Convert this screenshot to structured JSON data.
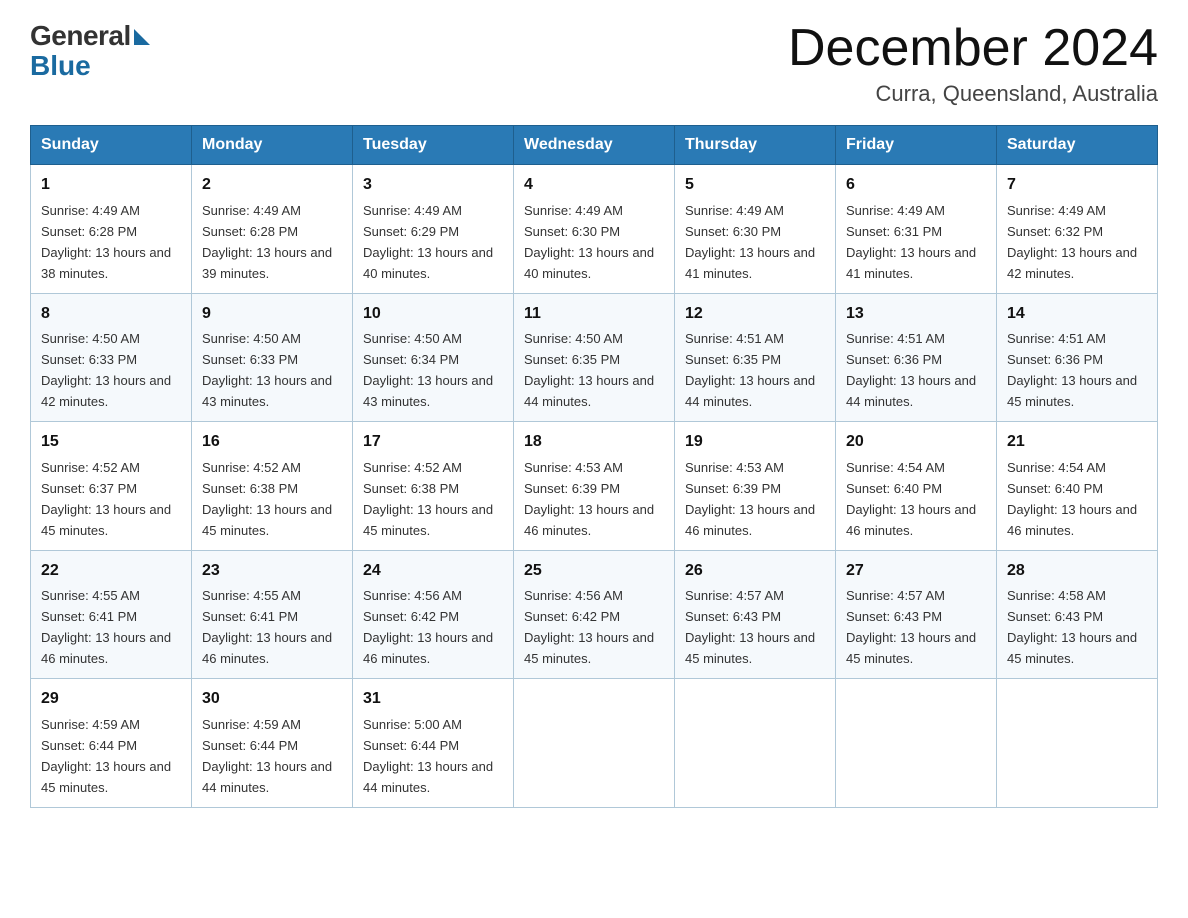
{
  "header": {
    "logo_general": "General",
    "logo_blue": "Blue",
    "month_title": "December 2024",
    "location": "Curra, Queensland, Australia"
  },
  "days_of_week": [
    "Sunday",
    "Monday",
    "Tuesday",
    "Wednesday",
    "Thursday",
    "Friday",
    "Saturday"
  ],
  "weeks": [
    [
      {
        "day": "1",
        "sunrise": "4:49 AM",
        "sunset": "6:28 PM",
        "daylight": "13 hours and 38 minutes."
      },
      {
        "day": "2",
        "sunrise": "4:49 AM",
        "sunset": "6:28 PM",
        "daylight": "13 hours and 39 minutes."
      },
      {
        "day": "3",
        "sunrise": "4:49 AM",
        "sunset": "6:29 PM",
        "daylight": "13 hours and 40 minutes."
      },
      {
        "day": "4",
        "sunrise": "4:49 AM",
        "sunset": "6:30 PM",
        "daylight": "13 hours and 40 minutes."
      },
      {
        "day": "5",
        "sunrise": "4:49 AM",
        "sunset": "6:30 PM",
        "daylight": "13 hours and 41 minutes."
      },
      {
        "day": "6",
        "sunrise": "4:49 AM",
        "sunset": "6:31 PM",
        "daylight": "13 hours and 41 minutes."
      },
      {
        "day": "7",
        "sunrise": "4:49 AM",
        "sunset": "6:32 PM",
        "daylight": "13 hours and 42 minutes."
      }
    ],
    [
      {
        "day": "8",
        "sunrise": "4:50 AM",
        "sunset": "6:33 PM",
        "daylight": "13 hours and 42 minutes."
      },
      {
        "day": "9",
        "sunrise": "4:50 AM",
        "sunset": "6:33 PM",
        "daylight": "13 hours and 43 minutes."
      },
      {
        "day": "10",
        "sunrise": "4:50 AM",
        "sunset": "6:34 PM",
        "daylight": "13 hours and 43 minutes."
      },
      {
        "day": "11",
        "sunrise": "4:50 AM",
        "sunset": "6:35 PM",
        "daylight": "13 hours and 44 minutes."
      },
      {
        "day": "12",
        "sunrise": "4:51 AM",
        "sunset": "6:35 PM",
        "daylight": "13 hours and 44 minutes."
      },
      {
        "day": "13",
        "sunrise": "4:51 AM",
        "sunset": "6:36 PM",
        "daylight": "13 hours and 44 minutes."
      },
      {
        "day": "14",
        "sunrise": "4:51 AM",
        "sunset": "6:36 PM",
        "daylight": "13 hours and 45 minutes."
      }
    ],
    [
      {
        "day": "15",
        "sunrise": "4:52 AM",
        "sunset": "6:37 PM",
        "daylight": "13 hours and 45 minutes."
      },
      {
        "day": "16",
        "sunrise": "4:52 AM",
        "sunset": "6:38 PM",
        "daylight": "13 hours and 45 minutes."
      },
      {
        "day": "17",
        "sunrise": "4:52 AM",
        "sunset": "6:38 PM",
        "daylight": "13 hours and 45 minutes."
      },
      {
        "day": "18",
        "sunrise": "4:53 AM",
        "sunset": "6:39 PM",
        "daylight": "13 hours and 46 minutes."
      },
      {
        "day": "19",
        "sunrise": "4:53 AM",
        "sunset": "6:39 PM",
        "daylight": "13 hours and 46 minutes."
      },
      {
        "day": "20",
        "sunrise": "4:54 AM",
        "sunset": "6:40 PM",
        "daylight": "13 hours and 46 minutes."
      },
      {
        "day": "21",
        "sunrise": "4:54 AM",
        "sunset": "6:40 PM",
        "daylight": "13 hours and 46 minutes."
      }
    ],
    [
      {
        "day": "22",
        "sunrise": "4:55 AM",
        "sunset": "6:41 PM",
        "daylight": "13 hours and 46 minutes."
      },
      {
        "day": "23",
        "sunrise": "4:55 AM",
        "sunset": "6:41 PM",
        "daylight": "13 hours and 46 minutes."
      },
      {
        "day": "24",
        "sunrise": "4:56 AM",
        "sunset": "6:42 PM",
        "daylight": "13 hours and 46 minutes."
      },
      {
        "day": "25",
        "sunrise": "4:56 AM",
        "sunset": "6:42 PM",
        "daylight": "13 hours and 45 minutes."
      },
      {
        "day": "26",
        "sunrise": "4:57 AM",
        "sunset": "6:43 PM",
        "daylight": "13 hours and 45 minutes."
      },
      {
        "day": "27",
        "sunrise": "4:57 AM",
        "sunset": "6:43 PM",
        "daylight": "13 hours and 45 minutes."
      },
      {
        "day": "28",
        "sunrise": "4:58 AM",
        "sunset": "6:43 PM",
        "daylight": "13 hours and 45 minutes."
      }
    ],
    [
      {
        "day": "29",
        "sunrise": "4:59 AM",
        "sunset": "6:44 PM",
        "daylight": "13 hours and 45 minutes."
      },
      {
        "day": "30",
        "sunrise": "4:59 AM",
        "sunset": "6:44 PM",
        "daylight": "13 hours and 44 minutes."
      },
      {
        "day": "31",
        "sunrise": "5:00 AM",
        "sunset": "6:44 PM",
        "daylight": "13 hours and 44 minutes."
      },
      null,
      null,
      null,
      null
    ]
  ],
  "colors": {
    "header_bg": "#2a7ab5",
    "header_text": "#ffffff",
    "border": "#b0c8d8"
  }
}
